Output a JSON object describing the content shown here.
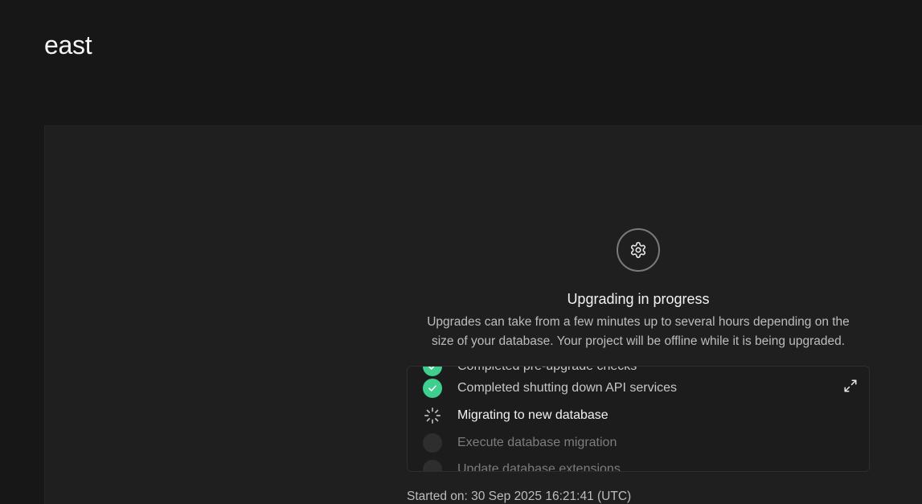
{
  "header": {
    "project_title": "east"
  },
  "upgrade": {
    "title": "Upgrading in progress",
    "description_line1": "Upgrades can take from a few minutes up to several hours depending on the",
    "description_line2": "size of your database. Your project will be offline while it is being upgraded.",
    "steps": [
      {
        "label": "Completed pre-upgrade checks",
        "status": "done"
      },
      {
        "label": "Completed shutting down API services",
        "status": "done"
      },
      {
        "label": "Migrating to new database",
        "status": "active"
      },
      {
        "label": "Execute database migration",
        "status": "pending"
      },
      {
        "label": "Update database extensions",
        "status": "pending"
      }
    ],
    "started_on": "Started on: 30 Sep 2025 16:21:41 (UTC)"
  },
  "icons": {
    "gear": "gear-icon",
    "check": "check-icon",
    "spinner": "spinner-icon",
    "expand": "expand-icon"
  },
  "colors": {
    "success": "#3ecf8e",
    "background": "#171717",
    "panel": "#1f1f1f"
  }
}
